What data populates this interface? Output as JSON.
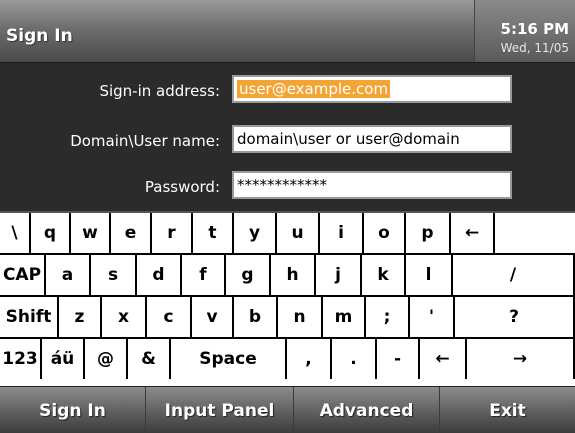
{
  "titlebar": {
    "title": "Sign In",
    "time": "5:16 PM",
    "date": "Wed, 11/05"
  },
  "form": {
    "signin_label": "Sign-in address:",
    "signin_value": "user@example.com",
    "domain_label": "Domain\\User name:",
    "domain_value": "domain\\user or user@domain",
    "password_label": "Password:",
    "password_value": "************"
  },
  "keyboard": {
    "row1": [
      "\\",
      "q",
      "w",
      "e",
      "r",
      "t",
      "y",
      "u",
      "i",
      "o",
      "p",
      "←"
    ],
    "row2": [
      "CAP",
      "a",
      "s",
      "d",
      "f",
      "g",
      "h",
      "j",
      "k",
      "l",
      "/"
    ],
    "row3": [
      "Shift",
      "z",
      "x",
      "c",
      "v",
      "b",
      "n",
      "m",
      ";",
      "'",
      "?"
    ],
    "row4": [
      "123",
      "áü",
      "@",
      "&",
      "Space",
      ",",
      ".",
      "-",
      "←",
      "→"
    ]
  },
  "bottombar": {
    "signin": "Sign In",
    "input_panel": "Input Panel",
    "advanced": "Advanced",
    "exit": "Exit"
  }
}
